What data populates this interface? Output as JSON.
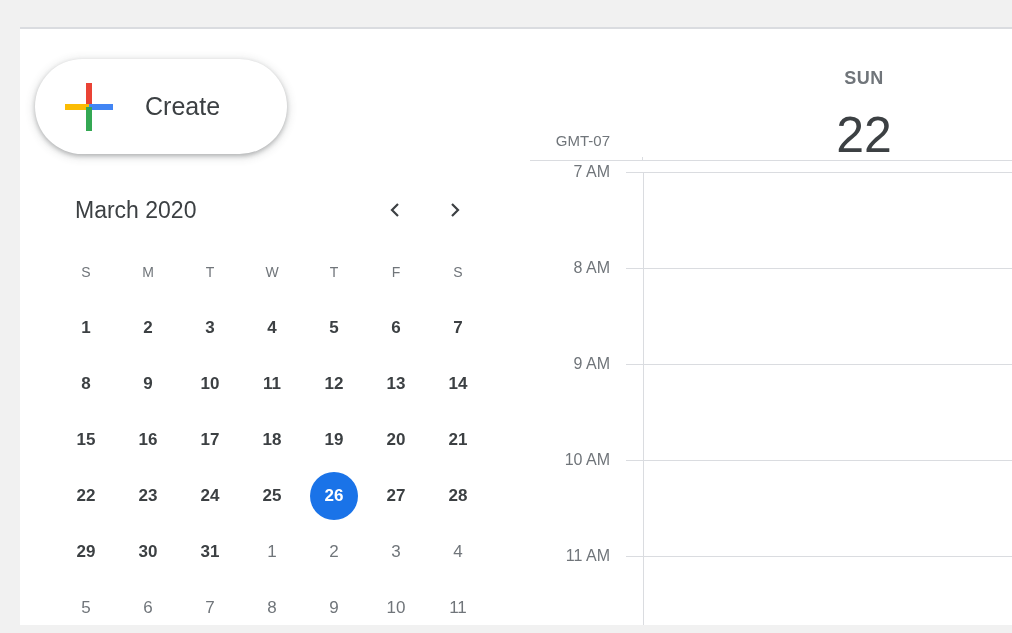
{
  "create_button": {
    "label": "Create"
  },
  "mini_calendar": {
    "title": "March 2020",
    "weekdays": [
      "S",
      "M",
      "T",
      "W",
      "T",
      "F",
      "S"
    ],
    "weeks": [
      [
        {
          "day": "1",
          "in_month": true,
          "selected": false
        },
        {
          "day": "2",
          "in_month": true,
          "selected": false
        },
        {
          "day": "3",
          "in_month": true,
          "selected": false
        },
        {
          "day": "4",
          "in_month": true,
          "selected": false
        },
        {
          "day": "5",
          "in_month": true,
          "selected": false
        },
        {
          "day": "6",
          "in_month": true,
          "selected": false
        },
        {
          "day": "7",
          "in_month": true,
          "selected": false
        }
      ],
      [
        {
          "day": "8",
          "in_month": true,
          "selected": false
        },
        {
          "day": "9",
          "in_month": true,
          "selected": false
        },
        {
          "day": "10",
          "in_month": true,
          "selected": false
        },
        {
          "day": "11",
          "in_month": true,
          "selected": false
        },
        {
          "day": "12",
          "in_month": true,
          "selected": false
        },
        {
          "day": "13",
          "in_month": true,
          "selected": false
        },
        {
          "day": "14",
          "in_month": true,
          "selected": false
        }
      ],
      [
        {
          "day": "15",
          "in_month": true,
          "selected": false
        },
        {
          "day": "16",
          "in_month": true,
          "selected": false
        },
        {
          "day": "17",
          "in_month": true,
          "selected": false
        },
        {
          "day": "18",
          "in_month": true,
          "selected": false
        },
        {
          "day": "19",
          "in_month": true,
          "selected": false
        },
        {
          "day": "20",
          "in_month": true,
          "selected": false
        },
        {
          "day": "21",
          "in_month": true,
          "selected": false
        }
      ],
      [
        {
          "day": "22",
          "in_month": true,
          "selected": false
        },
        {
          "day": "23",
          "in_month": true,
          "selected": false
        },
        {
          "day": "24",
          "in_month": true,
          "selected": false
        },
        {
          "day": "25",
          "in_month": true,
          "selected": false
        },
        {
          "day": "26",
          "in_month": true,
          "selected": true
        },
        {
          "day": "27",
          "in_month": true,
          "selected": false
        },
        {
          "day": "28",
          "in_month": true,
          "selected": false
        }
      ],
      [
        {
          "day": "29",
          "in_month": true,
          "selected": false
        },
        {
          "day": "30",
          "in_month": true,
          "selected": false
        },
        {
          "day": "31",
          "in_month": true,
          "selected": false
        },
        {
          "day": "1",
          "in_month": false,
          "selected": false
        },
        {
          "day": "2",
          "in_month": false,
          "selected": false
        },
        {
          "day": "3",
          "in_month": false,
          "selected": false
        },
        {
          "day": "4",
          "in_month": false,
          "selected": false
        }
      ],
      [
        {
          "day": "5",
          "in_month": false,
          "selected": false
        },
        {
          "day": "6",
          "in_month": false,
          "selected": false
        },
        {
          "day": "7",
          "in_month": false,
          "selected": false
        },
        {
          "day": "8",
          "in_month": false,
          "selected": false
        },
        {
          "day": "9",
          "in_month": false,
          "selected": false
        },
        {
          "day": "10",
          "in_month": false,
          "selected": false
        },
        {
          "day": "11",
          "in_month": false,
          "selected": false
        }
      ]
    ]
  },
  "timezone": "GMT-07",
  "day_header": {
    "weekday": "SUN",
    "date": "22"
  },
  "hours": [
    "7 AM",
    "8 AM",
    "9 AM",
    "10 AM",
    "11 AM"
  ]
}
